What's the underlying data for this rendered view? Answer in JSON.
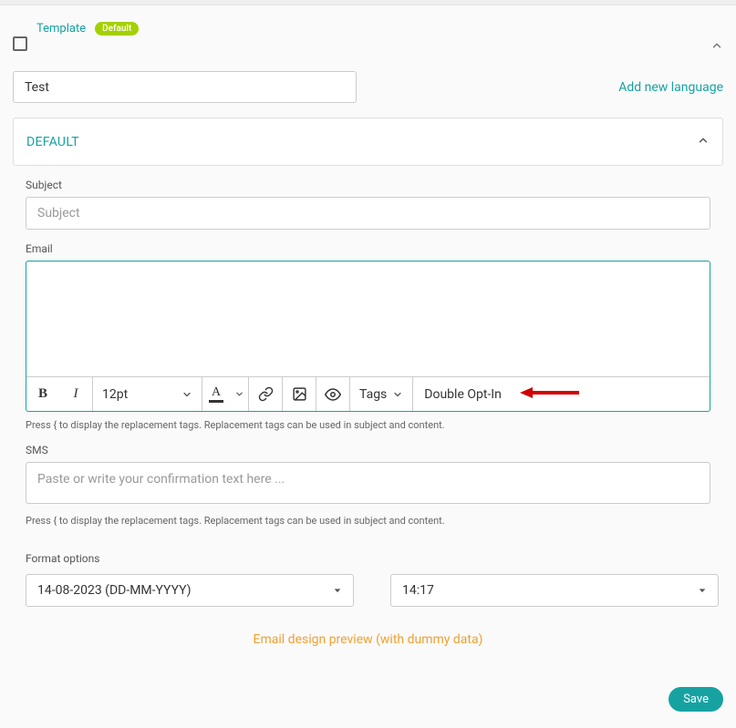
{
  "header": {
    "template_label": "Template",
    "badge": "Default"
  },
  "name_input": "Test",
  "add_language": "Add new language",
  "panel_title": "DEFAULT",
  "subject": {
    "label": "Subject",
    "placeholder": "Subject",
    "value": ""
  },
  "email": {
    "label": "Email",
    "value": ""
  },
  "toolbar": {
    "bold": "B",
    "italic": "I",
    "fontsize": "12pt",
    "textcolor_letter": "A",
    "tags": "Tags",
    "double_opt_in": "Double Opt-In"
  },
  "hint": "Press { to display the replacement tags. Replacement tags can be used in subject and content.",
  "sms": {
    "label": "SMS",
    "placeholder": "Paste or write your confirmation text here ...",
    "value": ""
  },
  "format": {
    "label": "Format options",
    "date": "14-08-2023 (DD-MM-YYYY)",
    "time": "14:17"
  },
  "preview_link": "Email design preview (with dummy data)",
  "save": "Save"
}
